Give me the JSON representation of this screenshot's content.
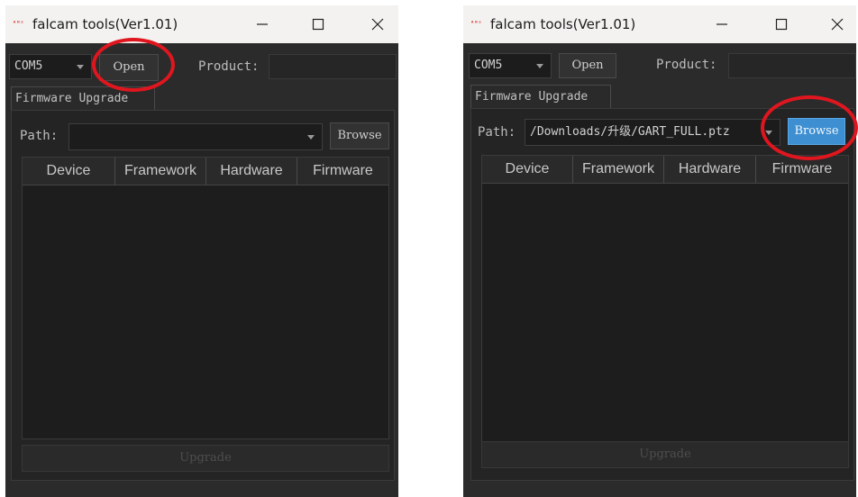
{
  "windows": [
    {
      "title": "falcam tools(Ver1.01)",
      "icon_text": "ᴬᴺˢ",
      "port_value": "COM5",
      "open_label": "Open",
      "product_label": "Product:",
      "tab_label": "Firmware Upgrade",
      "path_label": "Path:",
      "path_value": "",
      "browse_label": "Browse",
      "columns": [
        "Device",
        "Framework",
        "Hardware",
        "Firmware"
      ],
      "upgrade_label": "Upgrade"
    },
    {
      "title": "falcam tools(Ver1.01)",
      "icon_text": "ᴬᴺˢ",
      "port_value": "COM5",
      "open_label": "Open",
      "product_label": "Product:",
      "tab_label": "Firmware Upgrade",
      "path_label": "Path:",
      "path_value": "/Downloads/升级/GART_FULL.ptz",
      "browse_label": "Browse",
      "columns": [
        "Device",
        "Framework",
        "Hardware",
        "Firmware"
      ],
      "upgrade_label": "Upgrade"
    }
  ],
  "colors": {
    "titlebar_bg": "#f3f2f1",
    "window_bg": "#2b2b2b",
    "browse_active": "#3d8fd1",
    "annotation_circle": "#e0161f"
  },
  "icons": [
    "minimize-icon",
    "maximize-icon",
    "close-icon",
    "chevron-down-icon"
  ]
}
